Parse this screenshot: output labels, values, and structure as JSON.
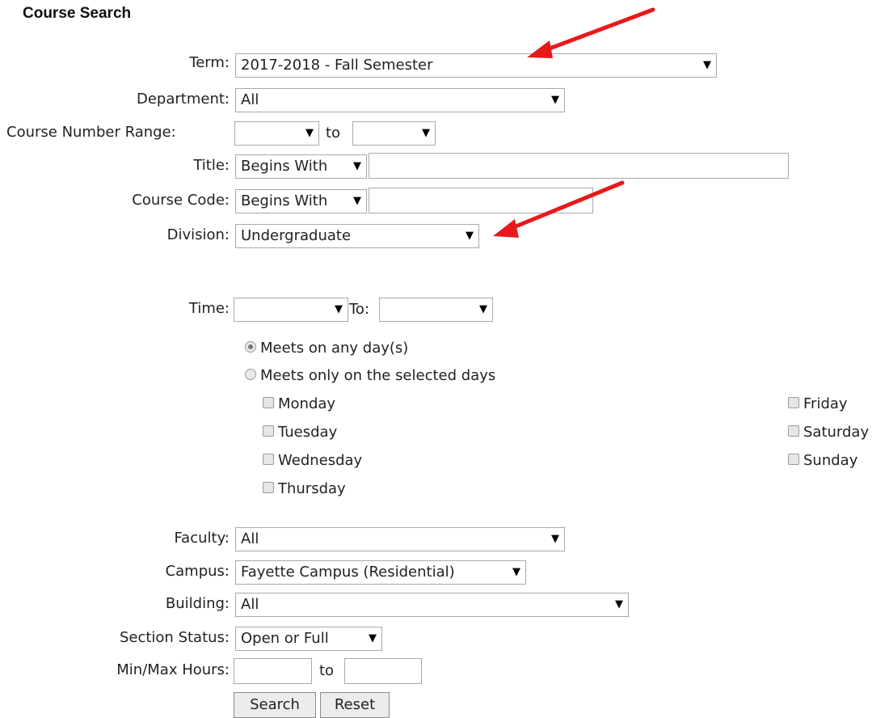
{
  "page": {
    "title": "Course Search"
  },
  "form": {
    "term": {
      "label": "Term:",
      "value": "2017-2018 - Fall Semester"
    },
    "department": {
      "label": "Department:",
      "value": "All"
    },
    "course_number_range": {
      "label": "Course Number Range:",
      "from": "",
      "to_label": "to",
      "to": ""
    },
    "title_field": {
      "label": "Title:",
      "mode": "Begins With",
      "value": ""
    },
    "course_code": {
      "label": "Course Code:",
      "mode": "Begins With",
      "value": ""
    },
    "division": {
      "label": "Division:",
      "value": "Undergraduate"
    },
    "time": {
      "label": "Time:",
      "from": "",
      "to_label": "To:",
      "to": ""
    },
    "meets": {
      "any_label": "Meets on any day(s)",
      "selected_label": "Meets only on the selected days",
      "selected": "any"
    },
    "days": {
      "monday": "Monday",
      "tuesday": "Tuesday",
      "wednesday": "Wednesday",
      "thursday": "Thursday",
      "friday": "Friday",
      "saturday": "Saturday",
      "sunday": "Sunday"
    },
    "faculty": {
      "label": "Faculty:",
      "value": "All"
    },
    "campus": {
      "label": "Campus:",
      "value": "Fayette Campus (Residential)"
    },
    "building": {
      "label": "Building:",
      "value": "All"
    },
    "section_status": {
      "label": "Section Status:",
      "value": "Open or Full"
    },
    "hours": {
      "label": "Min/Max Hours:",
      "min": "",
      "to_label": "to",
      "max": ""
    },
    "buttons": {
      "search": "Search",
      "reset": "Reset"
    }
  },
  "colors": {
    "annotation_arrow": "#e8191b"
  },
  "icons": {
    "dropdown": "dropdown-arrow-icon",
    "annotation": "red-arrow-annotation"
  }
}
